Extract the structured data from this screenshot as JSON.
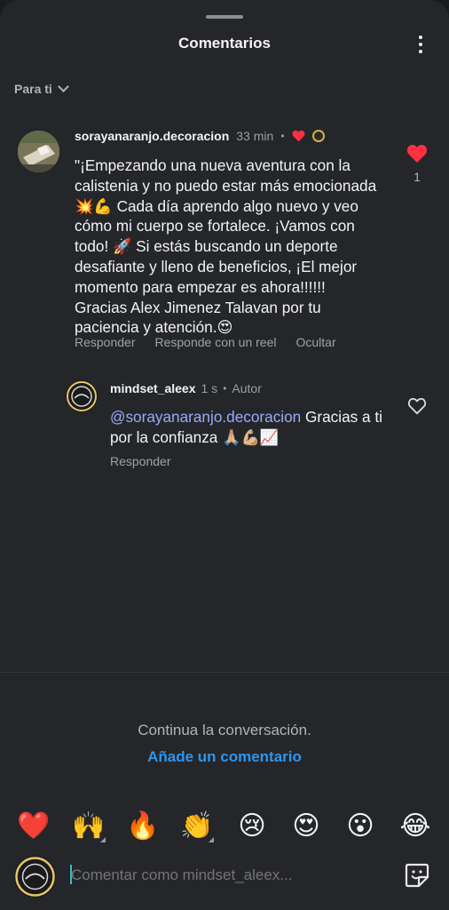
{
  "header": {
    "title": "Comentarios",
    "menu_icon": "more-vertical-icon"
  },
  "sort": {
    "label": "Para ti"
  },
  "comments": [
    {
      "username": "sorayanaranjo.decoracion",
      "time": "33 min",
      "separator": "•",
      "text": "\"¡Empezando una nueva aventura con la calistenia y no puedo estar más emocionada 💥💪 Cada día aprendo algo nuevo y veo cómo mi cuerpo se fortalece. ¡Vamos con todo! 🚀 Si estás buscando un deporte desafiante y lleno de beneficios, ¡El mejor momento para empezar es ahora!!!!!! Gracias Alex Jimenez Talavan por tu paciencia y atención.😍",
      "actions": {
        "reply": "Responder",
        "reel": "Responde con un reel",
        "hide": "Ocultar"
      },
      "likes": "1",
      "liked": true
    },
    {
      "username": "mindset_aleex",
      "time": "1 s",
      "separator": "•",
      "author_badge": "Autor",
      "mention": "@sorayanaranjo.decoracion",
      "text": " Gracias a ti por la confianza 🙏🏼💪🏼📈",
      "actions": {
        "reply": "Responder"
      },
      "liked": false
    }
  ],
  "footer": {
    "continue_text": "Continua la conversación.",
    "add_comment": "Añade un comentario"
  },
  "reactions": [
    "❤️",
    "🙌",
    "🔥",
    "👏",
    "😢",
    "😍",
    "😮",
    "😂"
  ],
  "composer": {
    "placeholder": "Comentar como mindset_aleex...",
    "sticker_icon": "sticker-icon"
  },
  "colors": {
    "background": "#25262a",
    "link": "#2e95f0",
    "mention": "#9aaaf8",
    "like": "#ff3040"
  }
}
